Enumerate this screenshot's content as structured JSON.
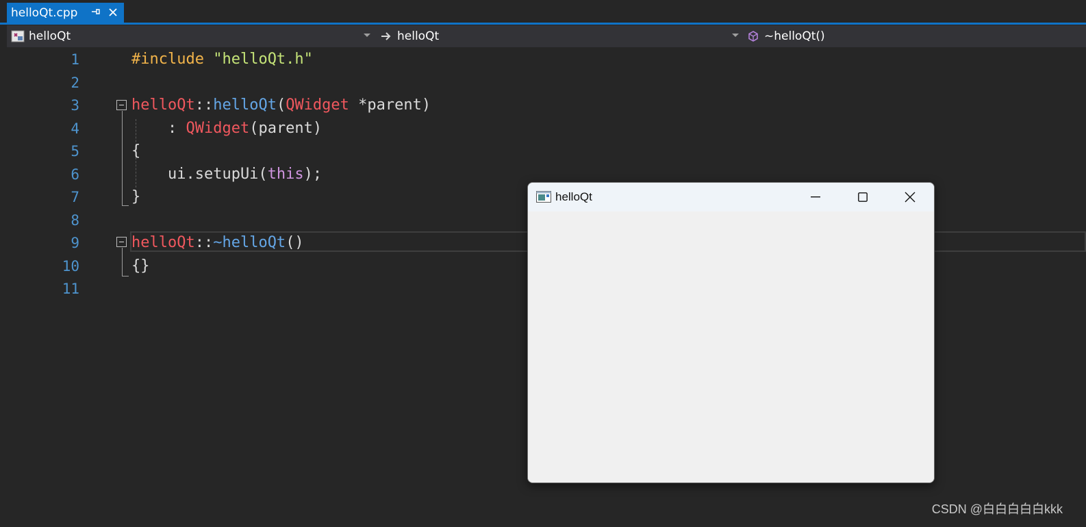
{
  "tab": {
    "filename": "helloQt.cpp",
    "pin_glyph": "⊣",
    "close_glyph": "✕",
    "accent": "#0f73c7"
  },
  "navbar": {
    "project": "helloQt",
    "scope": "helloQt",
    "member": "~helloQt()"
  },
  "code": {
    "colors": {
      "preprocessor": "#f2b44a",
      "string": "#c5e478",
      "class": "#f0585e",
      "function": "#64a6e6",
      "keyword": "#d095e0",
      "text": "#dadada",
      "line_number": "#4e94ce"
    },
    "lines": [
      {
        "n": "1",
        "tokens": [
          {
            "t": "#include ",
            "c": "pp"
          },
          {
            "t": "\"helloQt.h\"",
            "c": "str"
          }
        ]
      },
      {
        "n": "2",
        "tokens": []
      },
      {
        "n": "3",
        "tokens": [
          {
            "t": "helloQt",
            "c": "cls"
          },
          {
            "t": "::",
            "c": "def"
          },
          {
            "t": "helloQt",
            "c": "fn"
          },
          {
            "t": "(",
            "c": "def"
          },
          {
            "t": "QWidget",
            "c": "cls"
          },
          {
            "t": " *parent)",
            "c": "def"
          }
        ]
      },
      {
        "n": "4",
        "tokens": [
          {
            "t": "    : ",
            "c": "def"
          },
          {
            "t": "QWidget",
            "c": "cls"
          },
          {
            "t": "(parent)",
            "c": "def"
          }
        ]
      },
      {
        "n": "5",
        "tokens": [
          {
            "t": "{",
            "c": "def"
          }
        ]
      },
      {
        "n": "6",
        "tokens": [
          {
            "t": "    ui.setupUi(",
            "c": "def"
          },
          {
            "t": "this",
            "c": "kw"
          },
          {
            "t": ");",
            "c": "def"
          }
        ]
      },
      {
        "n": "7",
        "tokens": [
          {
            "t": "}",
            "c": "def"
          }
        ]
      },
      {
        "n": "8",
        "tokens": []
      },
      {
        "n": "9",
        "tokens": [
          {
            "t": "helloQt",
            "c": "cls"
          },
          {
            "t": "::",
            "c": "def"
          },
          {
            "t": "~helloQt",
            "c": "fn"
          },
          {
            "t": "()",
            "c": "def"
          }
        ]
      },
      {
        "n": "10",
        "tokens": [
          {
            "t": "{}",
            "c": "def"
          }
        ]
      },
      {
        "n": "11",
        "tokens": []
      }
    ]
  },
  "qt_window": {
    "title": "helloQt"
  },
  "watermark": "CSDN @白白白白白kkk"
}
